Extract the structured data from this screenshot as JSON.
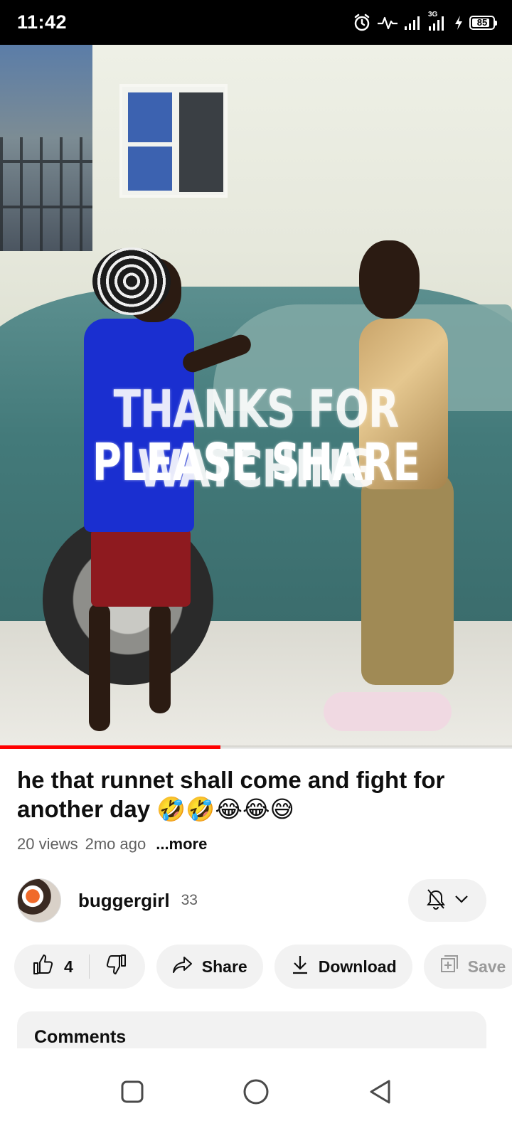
{
  "status_bar": {
    "time": "11:42",
    "network": "3G",
    "battery": "85",
    "icons": [
      "alarm-icon",
      "activity-icon",
      "signal-icon",
      "signal-3g-icon",
      "charging-icon",
      "battery-icon"
    ]
  },
  "video": {
    "overlay_line1": "THANKS FOR WATCHING",
    "overlay_line2": "PLEASE SHARE",
    "progress": 0.43,
    "progress_color": "#ff0000"
  },
  "info": {
    "title": "he that runnet shall come and fight for another day 🤣🤣😂😂😅",
    "views": "20 views",
    "age": "2mo ago",
    "more_label": "...more"
  },
  "channel": {
    "name": "buggergirl",
    "subscribers": "33",
    "bell_icon": "bell-off-icon",
    "chevron_icon": "chevron-down-icon"
  },
  "actions": {
    "like_count": "4",
    "share_label": "Share",
    "download_label": "Download",
    "save_label": "Save"
  },
  "comments": {
    "title": "Comments"
  },
  "nav": {
    "icons": [
      "recents-square-icon",
      "home-circle-icon",
      "back-triangle-icon"
    ]
  },
  "colors": {
    "accent": "#ff0000",
    "pill_bg": "#f2f2f2",
    "text_secondary": "#606060"
  }
}
